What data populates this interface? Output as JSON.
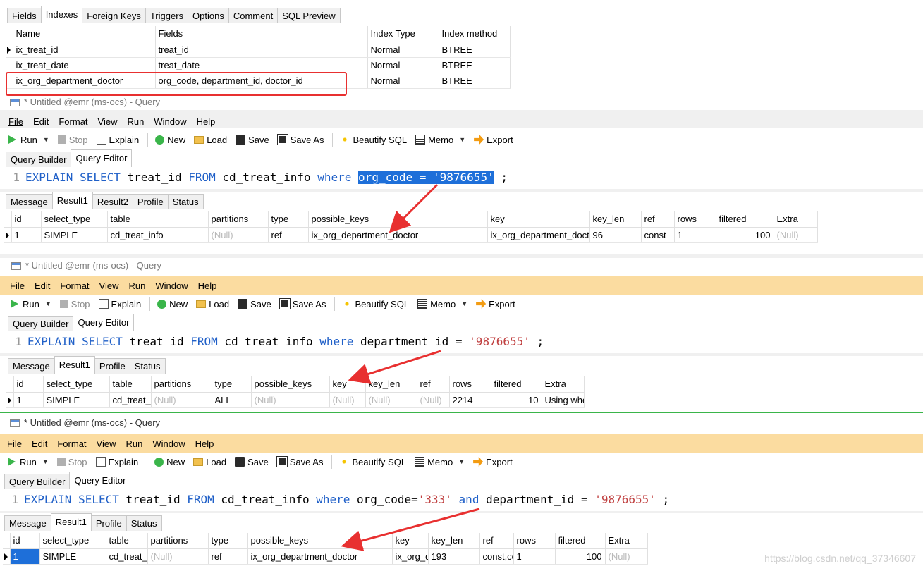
{
  "designer": {
    "tabs": [
      "Fields",
      "Indexes",
      "Foreign Keys",
      "Triggers",
      "Options",
      "Comment",
      "SQL Preview"
    ],
    "active_tab": "Indexes",
    "columns": [
      "Name",
      "Fields",
      "Index Type",
      "Index method"
    ],
    "rows": [
      {
        "name": "ix_treat_id",
        "fields": "treat_id",
        "type": "Normal",
        "method": "BTREE"
      },
      {
        "name": "ix_treat_date",
        "fields": "treat_date",
        "type": "Normal",
        "method": "BTREE"
      },
      {
        "name": "ix_org_department_doctor",
        "fields": "org_code, department_id, doctor_id",
        "type": "Normal",
        "method": "BTREE"
      }
    ]
  },
  "query_windows": [
    {
      "title": "* Untitled @emr (ms-ocs) - Query",
      "menu": [
        "File",
        "Edit",
        "Format",
        "View",
        "Run",
        "Window",
        "Help"
      ],
      "toolbar": {
        "run": "Run",
        "stop": "Stop",
        "explain": "Explain",
        "new": "New",
        "load": "Load",
        "save": "Save",
        "save_as": "Save As",
        "beautify": "Beautify SQL",
        "memo": "Memo",
        "export": "Export"
      },
      "editor_tabs": [
        "Query Builder",
        "Query Editor"
      ],
      "line_number": "1",
      "sql": {
        "p1": "EXPLAIN",
        "p2": "SELECT",
        "p3": " treat_id ",
        "p4": "FROM",
        "p5": " cd_treat_info ",
        "p6": "where",
        "p7": " ",
        "p8": "org_code = '9876655'",
        "p9": " ;"
      },
      "result_tabs": [
        "Message",
        "Result1",
        "Result2",
        "Profile",
        "Status"
      ],
      "columns": [
        "id",
        "select_type",
        "table",
        "partitions",
        "type",
        "possible_keys",
        "key",
        "key_len",
        "ref",
        "rows",
        "filtered",
        "Extra"
      ],
      "row": [
        "1",
        "SIMPLE",
        "cd_treat_info",
        "(Null)",
        "ref",
        "ix_org_department_doctor",
        "ix_org_department_doctor",
        "96",
        "const",
        "1",
        "100",
        "(Null)"
      ]
    },
    {
      "title": "* Untitled @emr (ms-ocs) - Query",
      "menu": [
        "File",
        "Edit",
        "Format",
        "View",
        "Run",
        "Window",
        "Help"
      ],
      "toolbar": {
        "run": "Run",
        "stop": "Stop",
        "explain": "Explain",
        "new": "New",
        "load": "Load",
        "save": "Save",
        "save_as": "Save As",
        "beautify": "Beautify SQL",
        "memo": "Memo",
        "export": "Export"
      },
      "editor_tabs": [
        "Query Builder",
        "Query Editor"
      ],
      "line_number": "1",
      "sql": {
        "p1": "EXPLAIN",
        "p2": "SELECT",
        "p3": " treat_id ",
        "p4": "FROM",
        "p5": " cd_treat_info ",
        "p6": "where",
        "p7": " department_id = ",
        "p8": "'9876655'",
        "p9": " ;"
      },
      "result_tabs": [
        "Message",
        "Result1",
        "Profile",
        "Status"
      ],
      "columns": [
        "id",
        "select_type",
        "table",
        "partitions",
        "type",
        "possible_keys",
        "key",
        "key_len",
        "ref",
        "rows",
        "filtered",
        "Extra"
      ],
      "row": [
        "1",
        "SIMPLE",
        "cd_treat_info",
        "(Null)",
        "ALL",
        "(Null)",
        "(Null)",
        "(Null)",
        "(Null)",
        "2214",
        "10",
        "Using where"
      ]
    },
    {
      "title": "* Untitled @emr (ms-ocs) - Query",
      "menu": [
        "File",
        "Edit",
        "Format",
        "View",
        "Run",
        "Window",
        "Help"
      ],
      "toolbar": {
        "run": "Run",
        "stop": "Stop",
        "explain": "Explain",
        "new": "New",
        "load": "Load",
        "save": "Save",
        "save_as": "Save As",
        "beautify": "Beautify SQL",
        "memo": "Memo",
        "export": "Export"
      },
      "editor_tabs": [
        "Query Builder",
        "Query Editor"
      ],
      "line_number": "1",
      "sql": {
        "p1": "EXPLAIN",
        "p2": "SELECT",
        "p3": " treat_id ",
        "p4": "FROM",
        "p5": " cd_treat_info ",
        "p6": "where",
        "p7": " org_code=",
        "p8": "'333'",
        "p9": " ",
        "p10": "and",
        "p11": " department_id = ",
        "p12": "'9876655'",
        "p13": " ;"
      },
      "result_tabs": [
        "Message",
        "Result1",
        "Profile",
        "Status"
      ],
      "columns": [
        "id",
        "select_type",
        "table",
        "partitions",
        "type",
        "possible_keys",
        "key",
        "key_len",
        "ref",
        "rows",
        "filtered",
        "Extra"
      ],
      "row": [
        "1",
        "SIMPLE",
        "cd_treat_info",
        "(Null)",
        "ref",
        "ix_org_department_doctor",
        "ix_org_department_doctor",
        "193",
        "const,const",
        "1",
        "100",
        "(Null)"
      ]
    }
  ],
  "watermark": "https://blog.csdn.net/qq_37346607",
  "colors": {
    "highlight_band": "#fbdca0",
    "annotation_red": "#e83030",
    "keyword_blue": "#2060c8",
    "string_red": "#c04040"
  }
}
